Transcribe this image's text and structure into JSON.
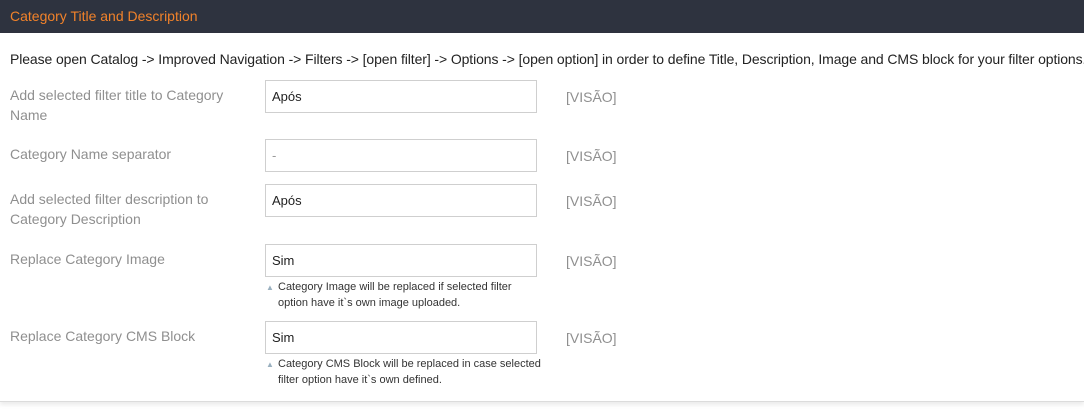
{
  "section": {
    "title": "Category Title and Description"
  },
  "notice": "Please open Catalog -> Improved Navigation -> Filters -> [open filter] -> Options -> [open option] in order to define Title, Description, Image and CMS block for your filter options.",
  "rows": [
    {
      "label": "Add selected filter title to Category Name",
      "value": "Após",
      "scope": "[VISÃO]"
    },
    {
      "label": "Category Name separator",
      "value": "-",
      "scope": "[VISÃO]"
    },
    {
      "label": "Add selected filter description to Category Description",
      "value": "Após",
      "scope": "[VISÃO]"
    },
    {
      "label": "Replace Category Image",
      "value": "Sim",
      "scope": "[VISÃO]",
      "note": "Category Image will be replaced if selected filter option have it`s own image uploaded."
    },
    {
      "label": "Replace Category CMS Block",
      "value": "Sim",
      "scope": "[VISÃO]",
      "note": "Category CMS Block will be replaced in case selected filter option have it`s own defined."
    }
  ],
  "icons": {
    "note_arrow": "triangle-up-icon"
  },
  "colors": {
    "header_bg": "#2e333f",
    "header_text": "#f1822a"
  }
}
